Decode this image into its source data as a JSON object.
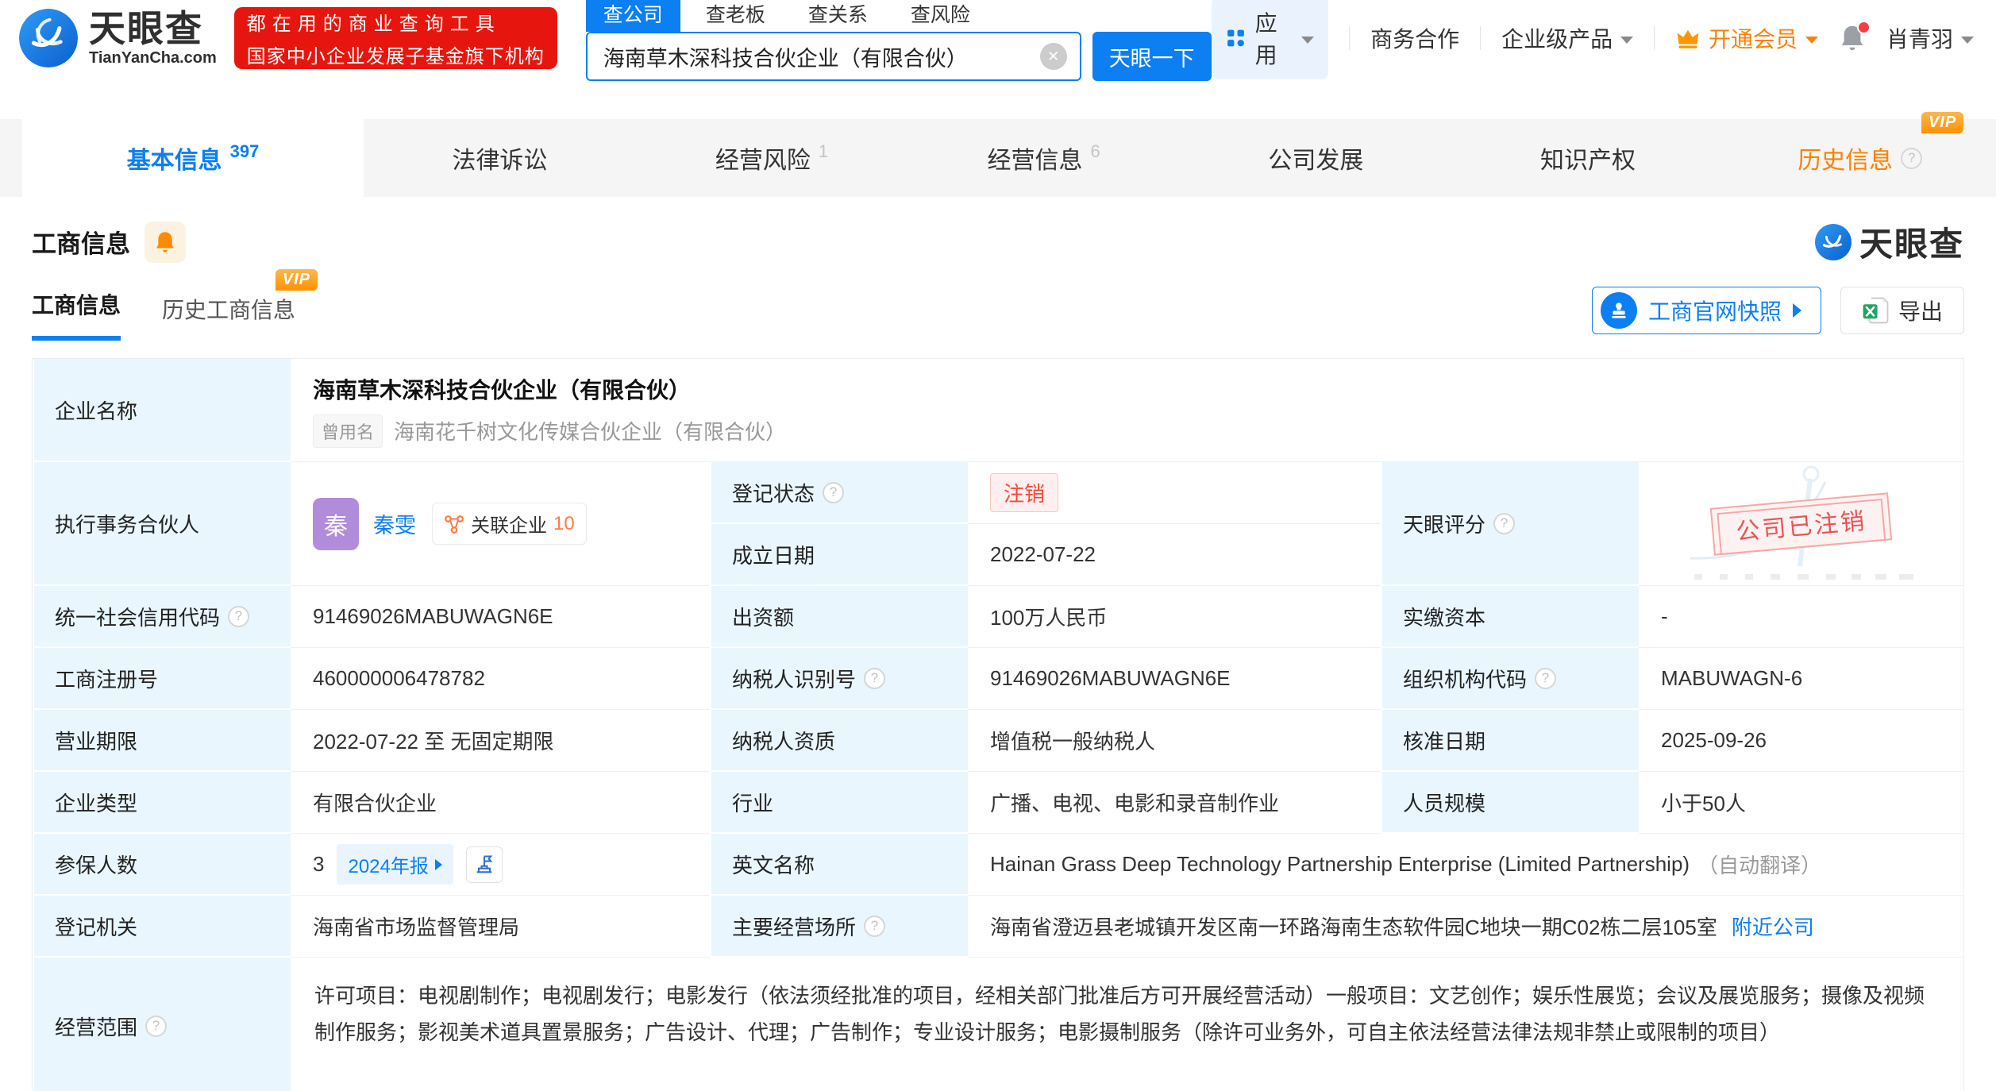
{
  "header": {
    "brand": "天眼查",
    "brand_domain": "TianYanCha.com",
    "promo": {
      "line1": "都在用的商业查询工具",
      "line2": "国家中小企业发展子基金旗下机构"
    },
    "search": {
      "tabs": [
        {
          "label": "查公司"
        },
        {
          "label": "查老板"
        },
        {
          "label": "查关系"
        },
        {
          "label": "查风险"
        }
      ],
      "value": "海南草木深科技合伙企业（有限合伙）",
      "submit": "天眼一下"
    },
    "nav": {
      "apps": "应用",
      "cooperation": "商务合作",
      "enterprise": "企业级产品",
      "vip": "开通会员",
      "username": "肖青羽"
    }
  },
  "badges": {
    "vip": "VIP"
  },
  "tabs": [
    {
      "label": "基本信息",
      "count": "397"
    },
    {
      "label": "法律诉讼"
    },
    {
      "label": "经营风险",
      "count": "1"
    },
    {
      "label": "经营信息",
      "count": "6"
    },
    {
      "label": "公司发展"
    },
    {
      "label": "知识产权"
    },
    {
      "label": "历史信息"
    }
  ],
  "section": {
    "title": "工商信息",
    "watermark": "天眼查",
    "subtabs": [
      {
        "label": "工商信息"
      },
      {
        "label": "历史工商信息"
      }
    ],
    "snapshot_button": "工商官网快照",
    "export_button": "导出"
  },
  "table": {
    "company_name": {
      "label": "企业名称",
      "value": "海南草木深科技合伙企业（有限合伙）",
      "former_badge": "曾用名",
      "former_value": "海南花千树文化传媒合伙企业（有限合伙）"
    },
    "partner": {
      "label": "执行事务合伙人",
      "avatar": "秦",
      "name": "秦雯",
      "related_label": "关联企业",
      "related_count": "10"
    },
    "reg_status": {
      "label": "登记状态",
      "value": "注销"
    },
    "est_date": {
      "label": "成立日期",
      "value": "2022-07-22"
    },
    "score": {
      "label": "天眼评分",
      "stamp": "公司已注销"
    },
    "credit_code": {
      "label": "统一社会信用代码",
      "value": "91469026MABUWAGN6E"
    },
    "contribution": {
      "label": "出资额",
      "value": "100万人民币"
    },
    "paid_capital": {
      "label": "实缴资本",
      "value": "-"
    },
    "reg_number": {
      "label": "工商注册号",
      "value": "460000006478782"
    },
    "taxpayer_id": {
      "label": "纳税人识别号",
      "value": "91469026MABUWAGN6E"
    },
    "org_code": {
      "label": "组织机构代码",
      "value": "MABUWAGN-6"
    },
    "business_term": {
      "label": "营业期限",
      "value": "2022-07-22 至 无固定期限"
    },
    "taxpayer_quality": {
      "label": "纳税人资质",
      "value": "增值税一般纳税人"
    },
    "approval_date": {
      "label": "核准日期",
      "value": "2025-09-26"
    },
    "company_type": {
      "label": "企业类型",
      "value": "有限合伙企业"
    },
    "industry": {
      "label": "行业",
      "value": "广播、电视、电影和录音制作业"
    },
    "staff_size": {
      "label": "人员规模",
      "value": "小于50人"
    },
    "insured": {
      "label": "参保人数",
      "value": "3",
      "report_link": "2024年报"
    },
    "english_name": {
      "label": "英文名称",
      "value": "Hainan Grass Deep Technology Partnership Enterprise (Limited Partnership)",
      "note": "（自动翻译）"
    },
    "reg_authority": {
      "label": "登记机关",
      "value": "海南省市场监督管理局"
    },
    "address": {
      "label": "主要经营场所",
      "value": "海南省澄迈县老城镇开发区南一环路海南生态软件园C地块一期C02栋二层105室",
      "nearby_link": "附近公司"
    },
    "business_scope": {
      "label": "经营范围",
      "value": "许可项目：电视剧制作；电视剧发行；电影发行（依法须经批准的项目，经相关部门批准后方可开展经营活动）一般项目：文艺创作；娱乐性展览；会议及展览服务；摄像及视频制作服务；影视美术道具置景服务；广告设计、代理；广告制作；专业设计服务；电影摄制服务（除许可业务外，可自主依法经营法律法规非禁止或限制的项目）"
    }
  },
  "colors": {
    "accent_blue": "#0c7ff2",
    "vip_orange": "#ff8000",
    "danger_red": "#f5483b",
    "label_bg": "#e9f6fe"
  }
}
